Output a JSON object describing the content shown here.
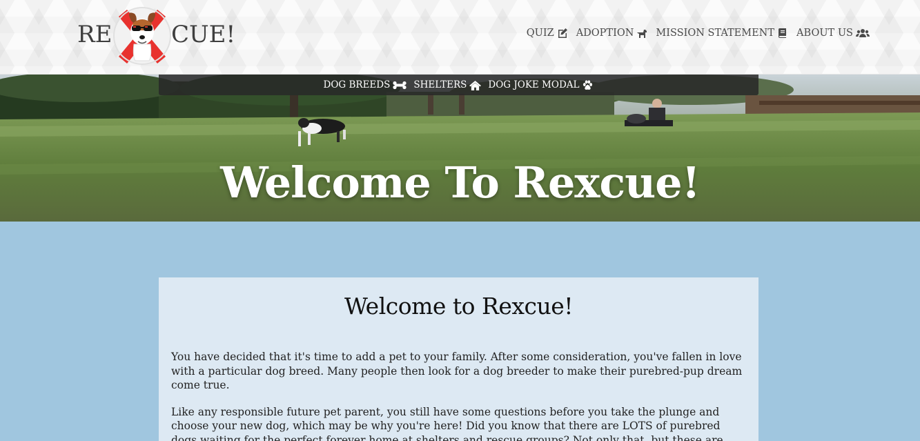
{
  "header": {
    "logo_left": "RE",
    "logo_right": "CUE!",
    "nav": [
      {
        "label": "QUIZ",
        "icon": "edit-icon"
      },
      {
        "label": "ADOPTION",
        "icon": "dog-icon"
      },
      {
        "label": "MISSION STATEMENT",
        "icon": "book-icon"
      },
      {
        "label": "ABOUT US",
        "icon": "users-icon"
      }
    ]
  },
  "hero": {
    "subnav": [
      {
        "label": "DOG BREEDS",
        "icon": "bone-icon"
      },
      {
        "label": "SHELTERS",
        "icon": "home-icon"
      },
      {
        "label": "DOG JOKE MODAL",
        "icon": "paw-icon"
      }
    ],
    "title": "Welcome To Rexcue!"
  },
  "main": {
    "heading": "Welcome to Rexcue!",
    "paragraphs": [
      "You have decided that it's time to add a pet to your family. After some consideration, you've fallen in love with a particular dog breed. Many people then look for a dog breeder to make their purebred-pup dream come true.",
      "Like any responsible future pet parent, you still have some questions before you take the plunge and choose your new dog, which may be why you're here! Did you know that there are LOTS of purebred dogs waiting for the perfect forever home at shelters and rescue groups? Not only that, but these are dogs"
    ]
  },
  "colors": {
    "page_bg": "#a0c6df",
    "card_bg": "#dde9f3",
    "subnav_bg": "#282828"
  }
}
